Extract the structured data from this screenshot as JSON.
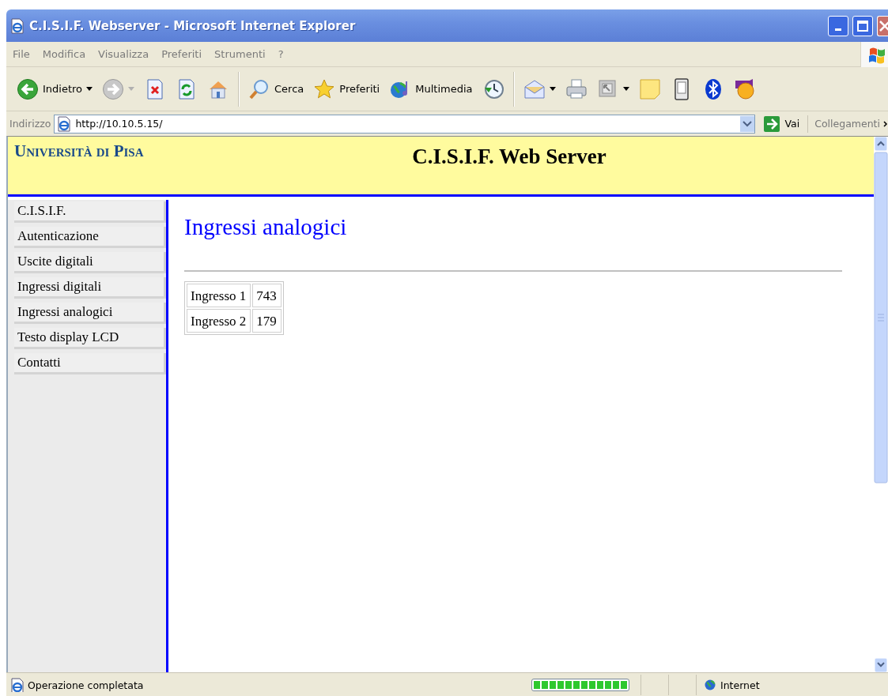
{
  "window": {
    "title": "C.I.S.I.F. Webserver - Microsoft Internet Explorer"
  },
  "menu": [
    "File",
    "Modifica",
    "Visualizza",
    "Preferiti",
    "Strumenti",
    "?"
  ],
  "toolbar": [
    {
      "kind": "back",
      "label": "Indietro"
    },
    {
      "kind": "forward"
    },
    {
      "kind": "stop"
    },
    {
      "kind": "refresh"
    },
    {
      "kind": "home"
    },
    {
      "kind": "search",
      "label": "Cerca"
    },
    {
      "kind": "favorites",
      "label": "Preferiti"
    },
    {
      "kind": "media",
      "label": "Multimedia"
    },
    {
      "kind": "history"
    },
    {
      "kind": "mail"
    },
    {
      "kind": "print"
    },
    {
      "kind": "screen"
    },
    {
      "kind": "note"
    },
    {
      "kind": "device"
    },
    {
      "kind": "bluetooth"
    },
    {
      "kind": "messenger"
    }
  ],
  "address": {
    "label": "Indirizzo",
    "value": "http://10.10.5.15/",
    "go": "Vai",
    "links": "Collegamenti"
  },
  "page": {
    "logo": "Università di Pisa",
    "title": "C.I.S.I.F. Web Server",
    "nav": [
      "C.I.S.I.F.",
      "Autenticazione",
      "Uscite digitali",
      "Ingressi digitali",
      "Ingressi analogici",
      "Testo display LCD",
      "Contatti"
    ],
    "heading": "Ingressi analogici",
    "table": [
      [
        "Ingresso 1",
        "743"
      ],
      [
        "Ingresso 2",
        "179"
      ]
    ]
  },
  "status": {
    "text": "Operazione completata",
    "progress": {
      "level": 1
    },
    "zone": "Internet"
  }
}
